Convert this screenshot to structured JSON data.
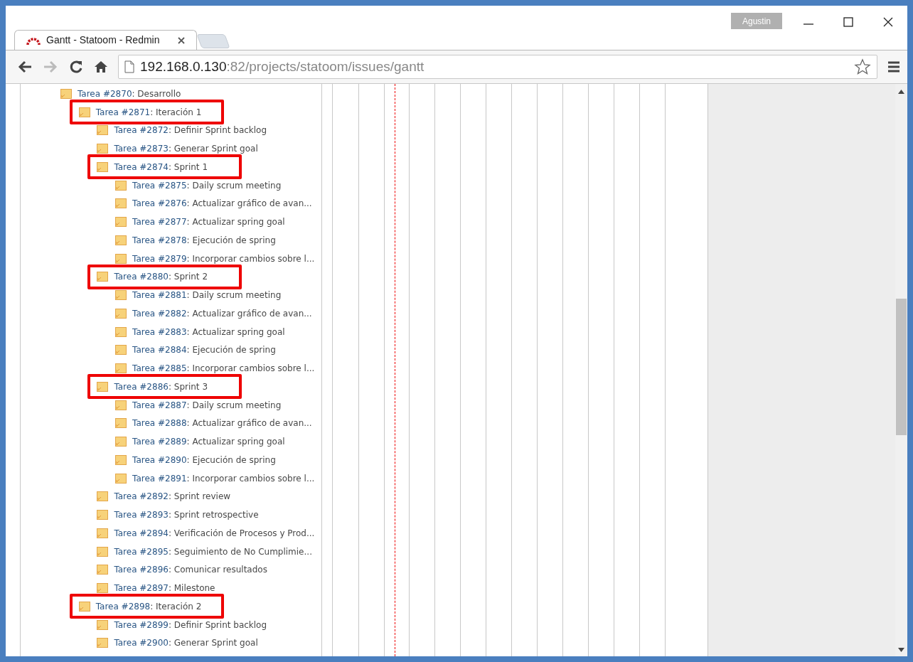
{
  "browser": {
    "tabs": [
      {
        "title": "Gantt - Statoom - Redmin",
        "selected": true
      }
    ],
    "profile": "Agustin",
    "address": {
      "host": "192.168.0.130",
      "path": ":82/projects/statoom/issues/gantt"
    },
    "forward_disabled": true
  },
  "gantt": {
    "issues": [
      {
        "link": "Tarea #2870",
        "subject": ": Desarrollo",
        "highlighted": false,
        "children": [
          {
            "link": "Tarea #2871",
            "subject": ": Iteración 1",
            "highlighted": true,
            "children": [
              {
                "link": "Tarea #2872",
                "subject": ": Definir Sprint backlog",
                "highlighted": false
              },
              {
                "link": "Tarea #2873",
                "subject": ": Generar Sprint goal",
                "highlighted": false
              },
              {
                "link": "Tarea #2874",
                "subject": ": Sprint 1",
                "highlighted": true,
                "children": [
                  {
                    "link": "Tarea #2875",
                    "subject": ": Daily scrum meeting",
                    "highlighted": false
                  },
                  {
                    "link": "Tarea #2876",
                    "subject": ": Actualizar gráfico de avan...",
                    "highlighted": false
                  },
                  {
                    "link": "Tarea #2877",
                    "subject": ": Actualizar spring goal",
                    "highlighted": false
                  },
                  {
                    "link": "Tarea #2878",
                    "subject": ": Ejecución de spring",
                    "highlighted": false
                  },
                  {
                    "link": "Tarea #2879",
                    "subject": ": Incorporar cambios sobre l...",
                    "highlighted": false
                  }
                ]
              },
              {
                "link": "Tarea #2880",
                "subject": ": Sprint 2",
                "highlighted": true,
                "children": [
                  {
                    "link": "Tarea #2881",
                    "subject": ": Daily scrum meeting",
                    "highlighted": false
                  },
                  {
                    "link": "Tarea #2882",
                    "subject": ": Actualizar gráfico de avan...",
                    "highlighted": false
                  },
                  {
                    "link": "Tarea #2883",
                    "subject": ": Actualizar spring goal",
                    "highlighted": false
                  },
                  {
                    "link": "Tarea #2884",
                    "subject": ": Ejecución de spring",
                    "highlighted": false
                  },
                  {
                    "link": "Tarea #2885",
                    "subject": ": Incorporar cambios sobre l...",
                    "highlighted": false
                  }
                ]
              },
              {
                "link": "Tarea #2886",
                "subject": ": Sprint 3",
                "highlighted": true,
                "children": [
                  {
                    "link": "Tarea #2887",
                    "subject": ": Daily scrum meeting",
                    "highlighted": false
                  },
                  {
                    "link": "Tarea #2888",
                    "subject": ": Actualizar gráfico de avan...",
                    "highlighted": false
                  },
                  {
                    "link": "Tarea #2889",
                    "subject": ": Actualizar spring goal",
                    "highlighted": false
                  },
                  {
                    "link": "Tarea #2890",
                    "subject": ": Ejecución de spring",
                    "highlighted": false
                  },
                  {
                    "link": "Tarea #2891",
                    "subject": ": Incorporar cambios sobre l...",
                    "highlighted": false
                  }
                ]
              },
              {
                "link": "Tarea #2892",
                "subject": ": Sprint review",
                "highlighted": false
              },
              {
                "link": "Tarea #2893",
                "subject": ": Sprint retrospective",
                "highlighted": false
              },
              {
                "link": "Tarea #2894",
                "subject": ": Verificación de Procesos y Prod...",
                "highlighted": false
              },
              {
                "link": "Tarea #2895",
                "subject": ": Seguimiento de No Cumplimie...",
                "highlighted": false
              },
              {
                "link": "Tarea #2896",
                "subject": ": Comunicar resultados",
                "highlighted": false
              },
              {
                "link": "Tarea #2897",
                "subject": ": Milestone",
                "highlighted": false
              }
            ]
          },
          {
            "link": "Tarea #2898",
            "subject": ": Iteración 2",
            "highlighted": true,
            "children": [
              {
                "link": "Tarea #2899",
                "subject": ": Definir Sprint backlog",
                "highlighted": false
              },
              {
                "link": "Tarea #2900",
                "subject": ": Generar Sprint goal",
                "highlighted": false
              }
            ]
          }
        ]
      }
    ]
  }
}
